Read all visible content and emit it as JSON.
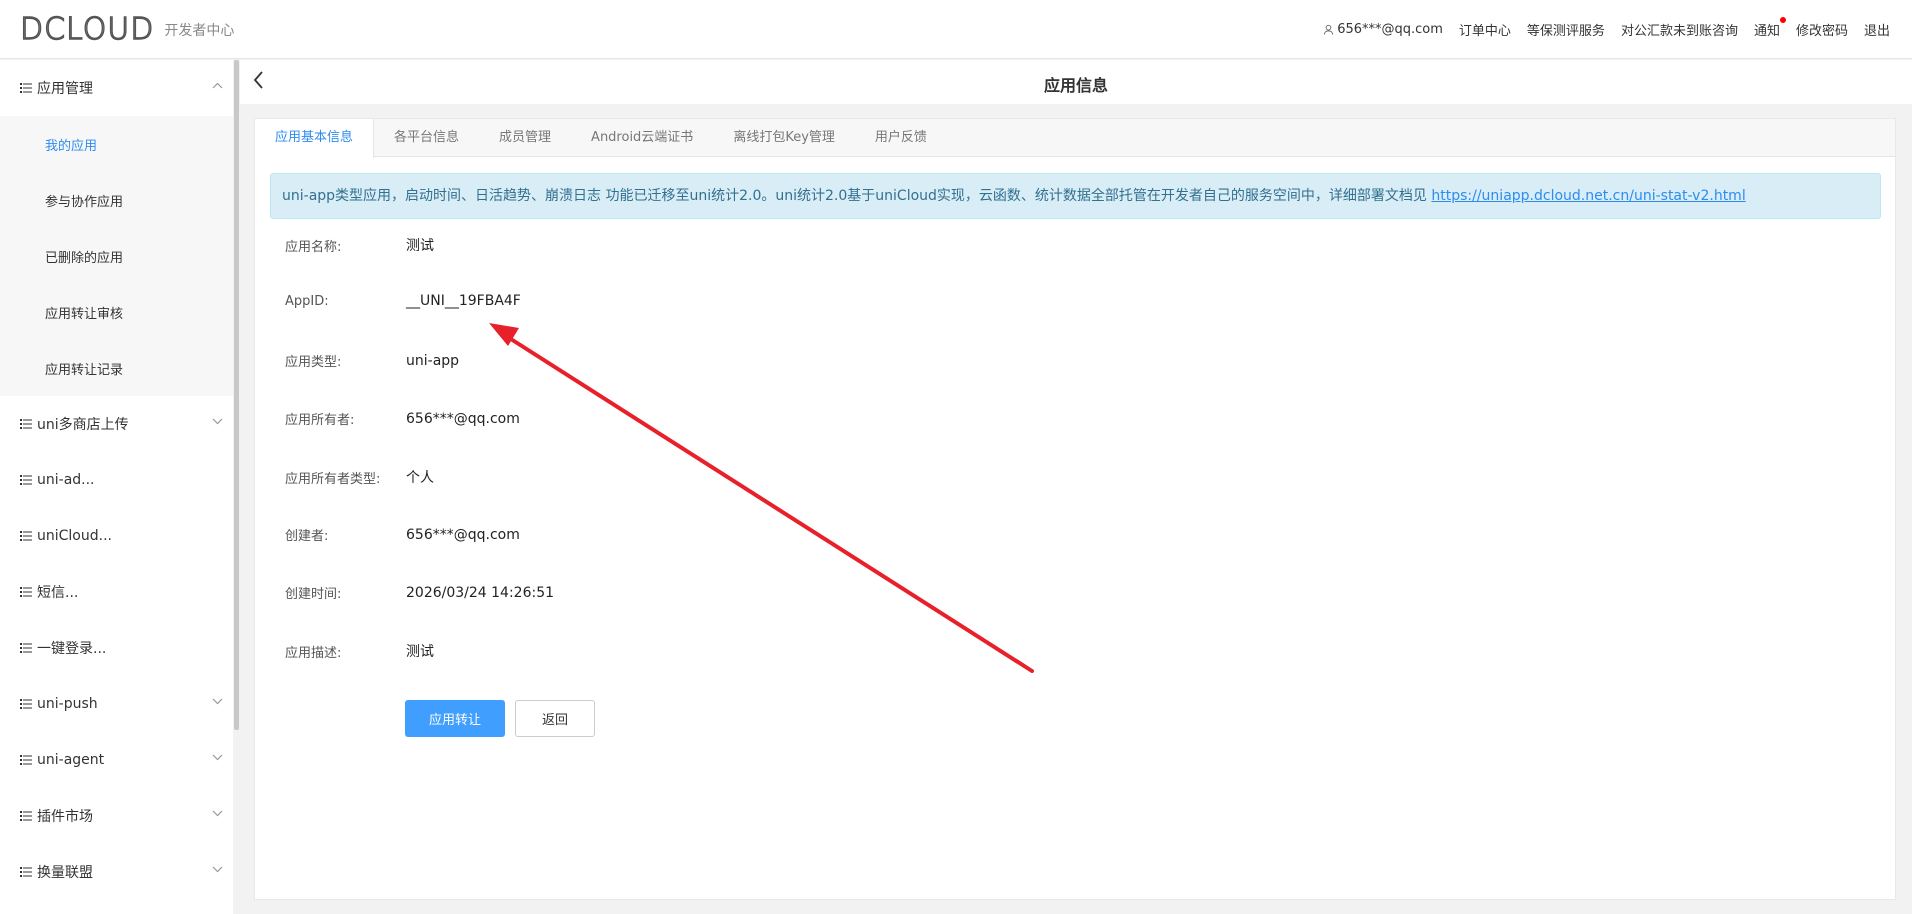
{
  "header": {
    "logo_text": "DCLOUD",
    "logo_sub": "开发者中心",
    "user": "656***@qq.com",
    "nav": [
      "订单中心",
      "等保测评服务",
      "对公汇款未到账咨询",
      "通知",
      "修改密码",
      "退出"
    ]
  },
  "sidebar": {
    "group1": {
      "label": "应用管理",
      "items": [
        "我的应用",
        "参与协作应用",
        "已删除的应用",
        "应用转让审核",
        "应用转让记录"
      ]
    },
    "items": [
      "uni多商店上传",
      "uni-ad...",
      "uniCloud...",
      "短信...",
      "一键登录...",
      "uni-push",
      "uni-agent",
      "插件市场",
      "换量联盟"
    ]
  },
  "page": {
    "title": "应用信息"
  },
  "tabs": [
    "应用基本信息",
    "各平台信息",
    "成员管理",
    "Android云端证书",
    "离线打包Key管理",
    "用户反馈"
  ],
  "notice": {
    "text": "uni-app类型应用，启动时间、日活趋势、崩溃日志 功能已迁移至uni统计2.0。uni统计2.0基于uniCloud实现，云函数、统计数据全部托管在开发者自己的服务空间中，详细部署文档见 ",
    "link": "https://uniapp.dcloud.net.cn/uni-stat-v2.html"
  },
  "info": [
    {
      "label": "应用名称:",
      "value": "测试"
    },
    {
      "label": "AppID:",
      "value": "__UNI__19FBA4F"
    },
    {
      "label": "应用类型:",
      "value": "uni-app"
    },
    {
      "label": "应用所有者:",
      "value": "656***@qq.com"
    },
    {
      "label": "应用所有者类型:",
      "value": "个人"
    },
    {
      "label": "创建者:",
      "value": "656***@qq.com"
    },
    {
      "label": "创建时间:",
      "value": "2026/03/24 14:26:51"
    },
    {
      "label": "应用描述:",
      "value": "测试"
    }
  ],
  "buttons": {
    "transfer": "应用转让",
    "back": "返回"
  },
  "colors": {
    "accent": "#2d8cf0",
    "primary_button": "#409eff",
    "notice_bg": "#d9edf7",
    "annotation_arrow": "#e8202a",
    "logo_d": "#e5642c"
  }
}
